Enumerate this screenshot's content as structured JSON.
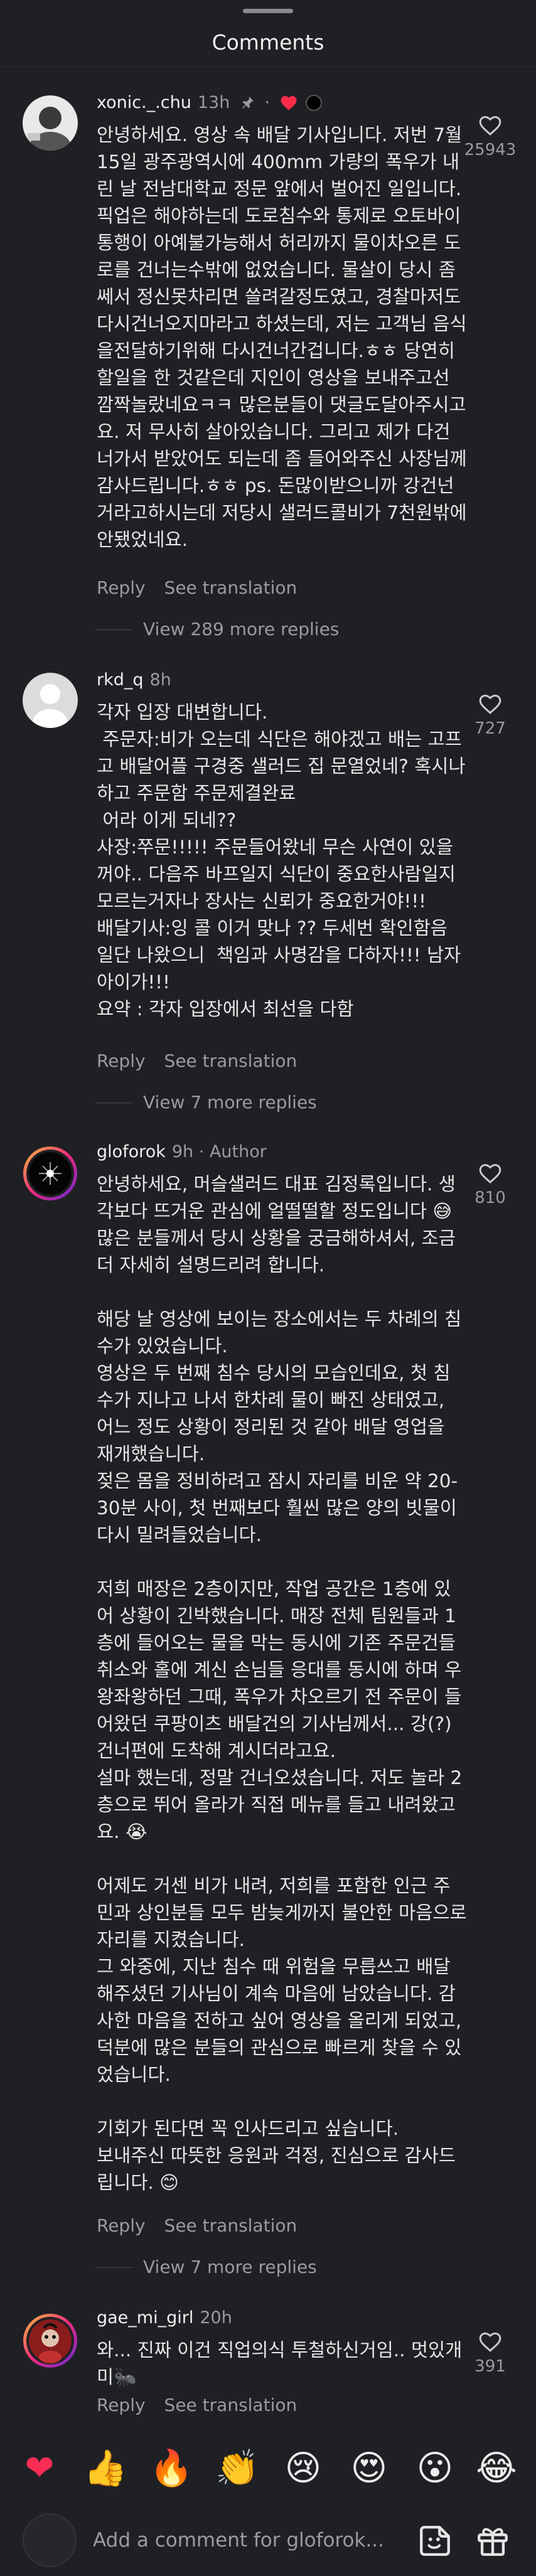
{
  "header": {
    "title": "Comments"
  },
  "comments": [
    {
      "username": "xonic._.chu",
      "time": "13h",
      "body": "안녕하세요. 영상 속 배달 기사입니다. 저번 7월 15일 광주광역시에 400mm 가량의 폭우가 내린 날 전남대학교 정문 앞에서 벌어진 일입니다. 픽업은 해야하는데 도로침수와 통제로 오토바이통행이 아예불가능해서 허리까지 물이차오른 도로를 건너는수밖에 없었습니다. 물살이 당시 좀쎄서 정신못차리면 쓸려갈정도였고, 경찰마저도 다시건너오지마라고 하셨는데, 저는 고객님 음식을전달하기위해 다시건너간겁니다.ㅎㅎ 당연히 할일을 한 것같은데 지인이 영상을 보내주고선 깜짝놀랐네요ㅋㅋ 많은분들이 댓글도달아주시고요. 저 무사히 살아있습니다. 그리고 제가 다건너가서 받았어도 되는데 좀 들어와주신 사장님께 감사드립니다.ㅎㅎ ps. 돈많이받으니까 강건넌거라고하시는데 저당시 샐러드콜비가 7천원밖에 안됐었네요.",
      "reply": "Reply",
      "see_translation": "See translation",
      "likes": "25943",
      "view_more": "View 289 more replies"
    },
    {
      "username": "rkd_q",
      "time": "8h",
      "body": "각자 입장 대변합니다.\n 주문자:비가 오는데 식단은 해야겠고 배는 고프고 배달어플 구경중 샐러드 집 문열었네? 혹시나하고 주문함 주문제결완료\n 어라 이게 되네??\n사장:쭈문!!!!! 주문들어왔네 무슨 사연이 있을꺼야.. 다음주 바프일지 식단이 중요한사람일지 모르는거자나 장사는 신뢰가 중요한거야!!!\n배달기사:잉 콜 이거 맞나 ?? 두세번 확인함음  일단 나왔으니  책임과 사명감을 다하자!!! 남자아이가!!!\n요약 : 각자 입장에서 최선을 다함",
      "reply": "Reply",
      "see_translation": "See translation",
      "likes": "727",
      "view_more": "View 7 more replies"
    },
    {
      "username": "gloforok",
      "time": "9h",
      "author_label": "Author",
      "body": "안녕하세요, 머슬샐러드 대표 김정록입니다. 생각보다 뜨거운 관심에 얼떨떨할 정도입니다 😅\n많은 분들께서 당시 상황을 궁금해하셔서, 조금 더 자세히 설명드리려 합니다.\n\n해당 날 영상에 보이는 장소에서는 두 차례의 침수가 있었습니다.\n영상은 두 번째 침수 당시의 모습인데요, 첫 침수가 지나고 나서 한차례 물이 빠진 상태였고, 어느 정도 상황이 정리된 것 같아 배달 영업을 재개했습니다.\n젖은 몸을 정비하려고 잠시 자리를 비운 약 20-30분 사이, 첫 번째보다 훨씬 많은 양의 빗물이 다시 밀려들었습니다.\n\n저희 매장은 2층이지만, 작업 공간은 1층에 있어 상황이 긴박했습니다. 매장 전체 팀원들과 1층에 들어오는 물을 막는 동시에 기존 주문건들 취소와 홀에 계신 손님들 응대를 동시에 하며 우왕좌왕하던 그때, 폭우가 차오르기 전 주문이 들어왔던 쿠팡이츠 배달건의 기사님께서... 강(?) 건너편에 도착해 계시더라고요.\n설마 했는데, 정말 건너오셨습니다. 저도 놀라 2층으로 뛰어 올라가 직접 메뉴를 들고 내려왔고요. 😭\n\n어제도 거센 비가 내려, 저희를 포함한 인근 주민과 상인분들 모두 밤늦게까지 불안한 마음으로 자리를 지켰습니다.\n그 와중에, 지난 침수 때 위험을 무릅쓰고 배달해주셨던 기사님이 계속 마음에 남았습니다. 감사한 마음을 전하고 싶어 영상을 올리게 되었고, 덕분에 많은 분들의 관심으로 빠르게 찾을 수 있었습니다.\n\n기회가 된다면 꼭 인사드리고 싶습니다.\n보내주신 따뜻한 응원과 걱정, 진심으로 감사드립니다. 😊",
      "reply": "Reply",
      "see_translation": "See translation",
      "likes": "810",
      "view_more": "View 7 more replies"
    },
    {
      "username": "gae_mi_girl",
      "time": "20h",
      "body": "와... 진짜 이건 직업의식 투철하신거임.. 멋있개미🐜",
      "reply": "Reply",
      "see_translation": "See translation",
      "likes": "391"
    }
  ],
  "emojis": [
    "❤",
    "👍",
    "🔥",
    "👏",
    "😢",
    "😍",
    "😮",
    "😂"
  ],
  "input": {
    "placeholder": "Add a comment for gloforok..."
  },
  "colors": {
    "background": "#1f2024",
    "heart_red": "#ff2d4a",
    "muted_text": "#9b9b9f"
  },
  "icons": [
    "pin-icon",
    "heart-icon",
    "sticker-icon",
    "gift-icon"
  ]
}
